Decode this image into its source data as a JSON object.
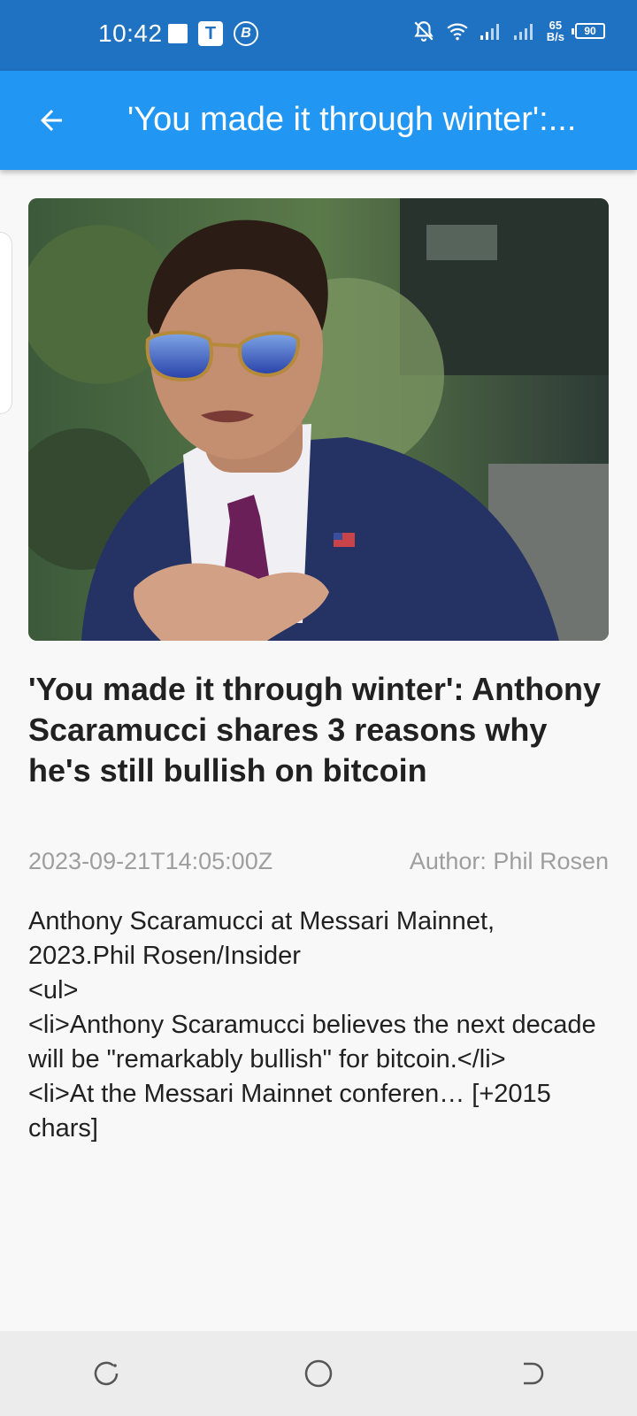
{
  "status_bar": {
    "time": "10:42",
    "net_speed_value": "65",
    "net_speed_unit": "B/s",
    "battery_level": "90",
    "icons": [
      "square-notification-icon",
      "t-app-icon",
      "b-app-icon",
      "mute-bell-icon",
      "wifi-icon",
      "signal-icon",
      "signal-icon",
      "battery-icon"
    ]
  },
  "app_bar": {
    "title": "'You made it through winter':..."
  },
  "article": {
    "image_alt": "Anthony Scaramucci",
    "title": "'You made it through winter': Anthony Scaramucci shares 3 reasons why he's still bullish on bitcoin",
    "published_at": "2023-09-21T14:05:00Z",
    "author": "Author: Phil Rosen",
    "body": "Anthony Scaramucci at Messari Mainnet, 2023.Phil Rosen/Insider\n<ul>\n<li>Anthony Scaramucci believes the next decade will be \"remarkably bullish\" for bitcoin.</li>\n<li>At the Messari Mainnet conferen… [+2015 chars]"
  },
  "nav_bar": {
    "icons": [
      "recent-apps-icon",
      "home-icon",
      "back-icon"
    ]
  },
  "colors": {
    "status_bar": "#1f72c2",
    "app_bar": "#2196f3",
    "background": "#f8f8f8",
    "meta_text": "#9e9e9e"
  }
}
